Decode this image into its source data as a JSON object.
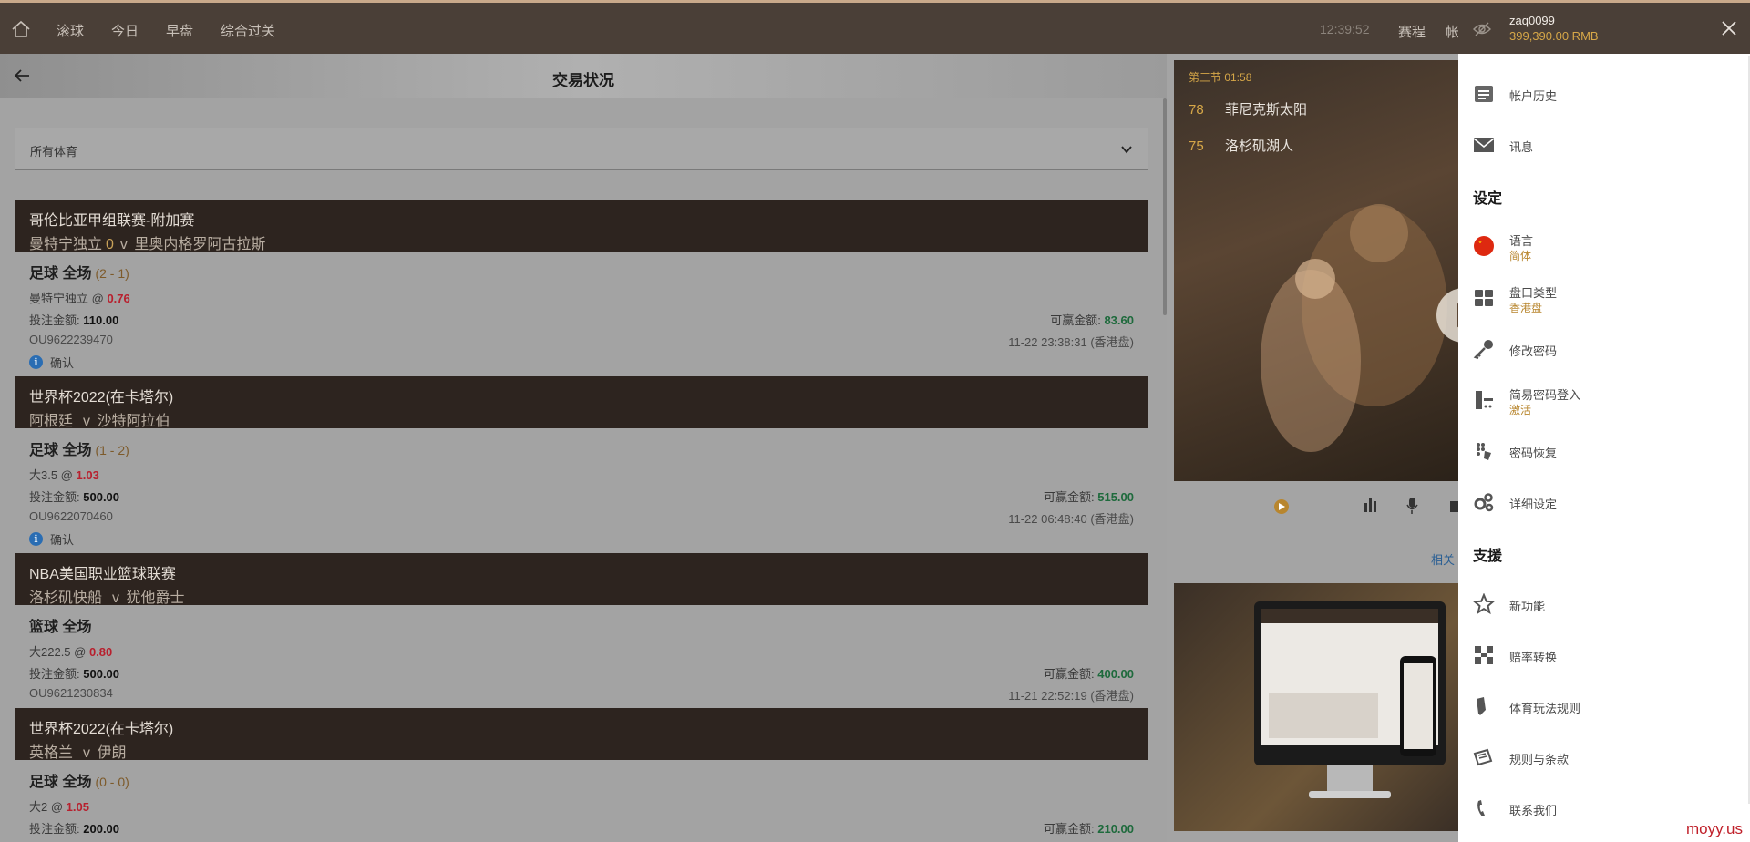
{
  "topnav": {
    "items": [
      "滚球",
      "今日",
      "早盘",
      "综合过关"
    ],
    "clock": "12:39:52",
    "right_links": [
      "赛程",
      "帐"
    ]
  },
  "page": {
    "title": "交易状况",
    "sport_filter": "所有体育"
  },
  "bets": [
    {
      "league": "哥伦比亚甲组联赛-附加赛",
      "home": "曼特宁独立",
      "score": "0",
      "away": "里奥内格罗阿古拉斯",
      "sport": "足球 全场",
      "result": "(2 - 1)",
      "selection": "曼特宁独立 @",
      "odds": "0.76",
      "stake_label": "投注金额:",
      "stake": "110.00",
      "win_label": "可赢金额:",
      "win": "83.60",
      "ref": "OU9622239470",
      "time": "11-22 23:38:31 (香港盘)",
      "status": "确认"
    },
    {
      "league": "世界杯2022(在卡塔尔)",
      "home": "阿根廷",
      "score": "",
      "away": "沙特阿拉伯",
      "sport": "足球 全场",
      "result": "(1 - 2)",
      "selection": "大3.5 @",
      "odds": "1.03",
      "stake_label": "投注金额:",
      "stake": "500.00",
      "win_label": "可赢金额:",
      "win": "515.00",
      "ref": "OU9622070460",
      "time": "11-22 06:48:40 (香港盘)",
      "status": "确认"
    },
    {
      "league": "NBA美国职业篮球联赛",
      "home": "洛杉矶快船",
      "score": "",
      "away": "犹他爵士",
      "sport": "篮球 全场",
      "result": "",
      "selection": "大222.5 @",
      "odds": "0.80",
      "stake_label": "投注金额:",
      "stake": "500.00",
      "win_label": "可赢金额:",
      "win": "400.00",
      "ref": "OU9621230834",
      "time": "11-21 22:52:19 (香港盘)",
      "status": ""
    },
    {
      "league": "世界杯2022(在卡塔尔)",
      "home": "英格兰",
      "score": "",
      "away": "伊朗",
      "sport": "足球 全场",
      "result": "(0 - 0)",
      "selection": "大2 @",
      "odds": "1.05",
      "stake_label": "投注金额:",
      "stake": "200.00",
      "win_label": "可赢金额:",
      "win": "210.00",
      "ref": "",
      "time": "",
      "status": ""
    }
  ],
  "live": {
    "period": "第三节 01:58",
    "team1_score": "78",
    "team1": "菲尼克斯太阳",
    "team2_score": "75",
    "team2": "洛杉矶湖人",
    "link": "相关"
  },
  "drawer": {
    "username": "zaq0099",
    "balance": "399,390.00  RMB",
    "items_top": [
      {
        "label": "帐户历史",
        "icon": "account-history-icon"
      },
      {
        "label": "讯息",
        "icon": "mail-icon"
      }
    ],
    "section_settings": "设定",
    "settings": [
      {
        "label": "语言",
        "sub": "简体",
        "icon": "china-flag-icon"
      },
      {
        "label": "盘口类型",
        "sub": "香港盘",
        "icon": "grid-icon"
      },
      {
        "label": "修改密码",
        "sub": "",
        "icon": "key-icon"
      },
      {
        "label": "简易密码登入",
        "sub": "激活",
        "icon": "pin-login-icon"
      },
      {
        "label": "密码恢复",
        "sub": "",
        "icon": "password-recovery-icon"
      },
      {
        "label": "详细设定",
        "sub": "",
        "icon": "settings-detail-icon"
      }
    ],
    "section_support": "支援",
    "support": [
      {
        "label": "新功能",
        "icon": "star-icon"
      },
      {
        "label": "赔率转换",
        "icon": "odds-convert-icon"
      },
      {
        "label": "体育玩法规则",
        "icon": "rules-icon"
      },
      {
        "label": "规则与条款",
        "icon": "terms-icon"
      },
      {
        "label": "联系我们",
        "icon": "phone-icon"
      }
    ]
  },
  "watermark": "moyy.us",
  "colors": {
    "topbar": "#4a3f37",
    "league_bar": "#2d241f",
    "gold": "#d6a748",
    "odds_red": "#b8202e",
    "win_green": "#1e6a3c"
  }
}
